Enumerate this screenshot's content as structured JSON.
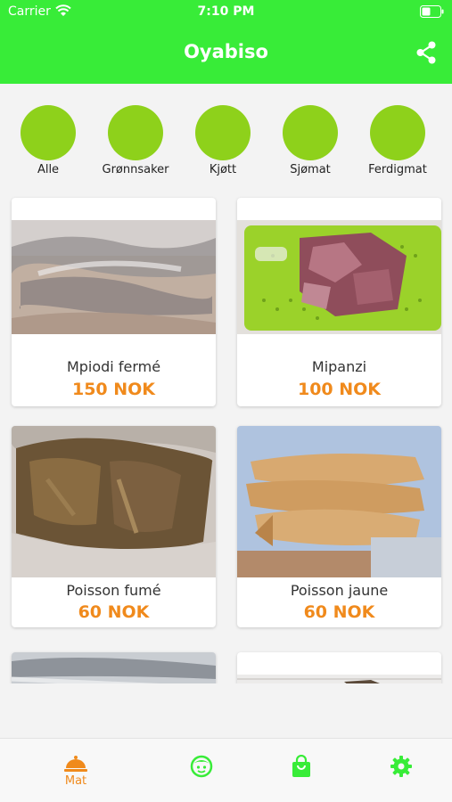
{
  "status_bar": {
    "carrier": "Carrier",
    "time": "7:10 PM"
  },
  "header": {
    "title": "Oyabiso"
  },
  "categories": [
    {
      "label": "Alle"
    },
    {
      "label": "Grønnsaker"
    },
    {
      "label": "Kjøtt"
    },
    {
      "label": "Sjømat"
    },
    {
      "label": "Ferdigmat"
    }
  ],
  "products": [
    {
      "name": "Mpiodi fermé",
      "price": "150 NOK"
    },
    {
      "name": "Mipanzi",
      "price": "100 NOK"
    },
    {
      "name": "Poisson fumé",
      "price": "60 NOK"
    },
    {
      "name": "Poisson jaune",
      "price": "60 NOK"
    }
  ],
  "tabbar": {
    "active_label": "Mat"
  },
  "colors": {
    "header_green": "#38ec38",
    "category_green": "#8ed11b",
    "price_orange": "#f08a1c"
  }
}
